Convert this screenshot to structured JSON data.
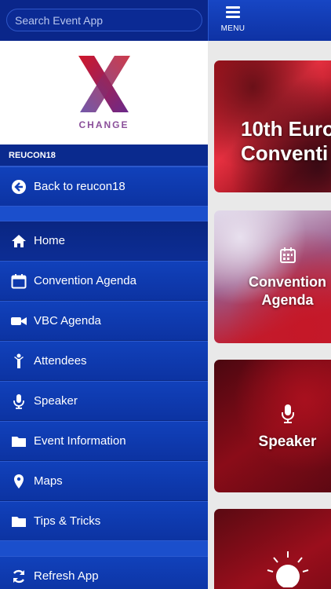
{
  "search": {
    "placeholder": "Search Event App"
  },
  "logo": {
    "text": "CHANGE"
  },
  "section": {
    "title": "REUCON18"
  },
  "nav": {
    "back": "Back to reucon18",
    "items": [
      {
        "label": "Home",
        "icon": "home-icon"
      },
      {
        "label": "Convention Agenda",
        "icon": "calendar-icon"
      },
      {
        "label": "VBC Agenda",
        "icon": "video-camera-icon"
      },
      {
        "label": "Attendees",
        "icon": "person-icon"
      },
      {
        "label": "Speaker",
        "icon": "microphone-icon"
      },
      {
        "label": "Event Information",
        "icon": "folder-icon"
      },
      {
        "label": "Maps",
        "icon": "map-pin-icon"
      },
      {
        "label": "Tips & Tricks",
        "icon": "folder-icon"
      }
    ],
    "refresh": "Refresh App"
  },
  "topbar": {
    "menu_label": "MENU"
  },
  "tiles": {
    "t1": {
      "line1": "10th Euro",
      "line2": "Conventi"
    },
    "t2": {
      "line1": "Convention",
      "line2": "Agenda"
    },
    "t3": {
      "title": "Speaker"
    }
  },
  "colors": {
    "drawer": "#0d2f9a",
    "accent": "#1141bb",
    "tile_red": "#b0121c"
  }
}
